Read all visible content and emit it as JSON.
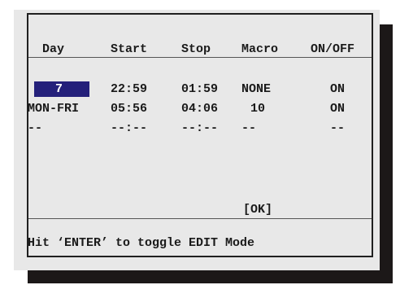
{
  "columns": {
    "day": "Day",
    "start": "Start",
    "stop": "Stop",
    "macro": "Macro",
    "onoff": "ON/OFF"
  },
  "rows": [
    {
      "day": "7",
      "start": "22:59",
      "stop": "01:59",
      "macro": "NONE",
      "onoff": "ON",
      "selected_field": "day"
    },
    {
      "day": "MON-FRI",
      "start": "05:56",
      "stop": "04:06",
      "macro": "10",
      "onoff": "ON"
    },
    {
      "day": "--",
      "start": "--:--",
      "stop": "--:--",
      "macro": "--",
      "onoff": "--"
    }
  ],
  "ok_button": "[OK]",
  "status": "Hit ‘ENTER’ to toggle EDIT Mode",
  "colors": {
    "highlight": "#24207a",
    "panel": "#e8e8e8",
    "shadow": "#1c1818",
    "text": "#1a1a1a"
  }
}
